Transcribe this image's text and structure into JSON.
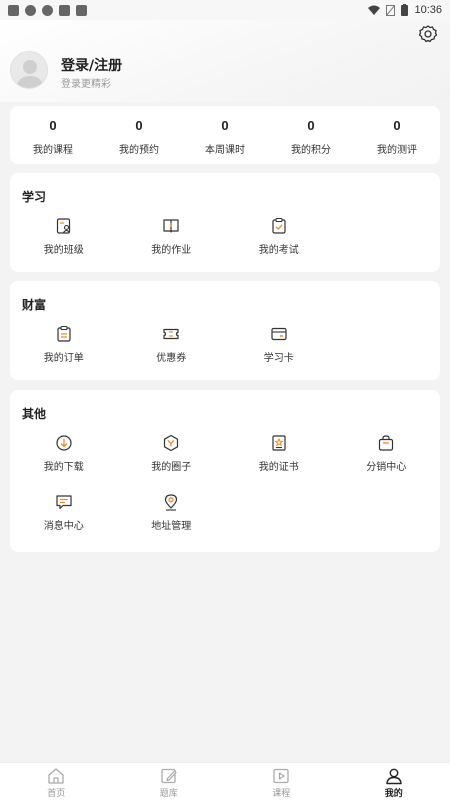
{
  "statusbar": {
    "time": "10:36"
  },
  "user": {
    "title": "登录/注册",
    "subtitle": "登录更精彩"
  },
  "stats": [
    {
      "value": "0",
      "label": "我的课程"
    },
    {
      "value": "0",
      "label": "我的预约"
    },
    {
      "value": "0",
      "label": "本周课时"
    },
    {
      "value": "0",
      "label": "我的积分"
    },
    {
      "value": "0",
      "label": "我的测评"
    }
  ],
  "study": {
    "title": "学习",
    "items": [
      {
        "label": "我的班级",
        "icon": "class-icon"
      },
      {
        "label": "我的作业",
        "icon": "homework-icon"
      },
      {
        "label": "我的考试",
        "icon": "exam-icon"
      }
    ]
  },
  "wealth": {
    "title": "财富",
    "items": [
      {
        "label": "我的订单",
        "icon": "order-icon"
      },
      {
        "label": "优惠券",
        "icon": "coupon-icon"
      },
      {
        "label": "学习卡",
        "icon": "card-icon"
      }
    ]
  },
  "other": {
    "title": "其他",
    "items": [
      {
        "label": "我的下载",
        "icon": "download-icon"
      },
      {
        "label": "我的圈子",
        "icon": "circle-icon"
      },
      {
        "label": "我的证书",
        "icon": "certificate-icon"
      },
      {
        "label": "分销中心",
        "icon": "distribution-icon"
      },
      {
        "label": "消息中心",
        "icon": "message-icon"
      },
      {
        "label": "地址管理",
        "icon": "location-icon"
      }
    ]
  },
  "tabs": [
    {
      "label": "首页",
      "icon": "home-icon",
      "active": false
    },
    {
      "label": "题库",
      "icon": "question-bank-icon",
      "active": false
    },
    {
      "label": "课程",
      "icon": "course-icon",
      "active": false
    },
    {
      "label": "我的",
      "icon": "profile-icon",
      "active": true
    }
  ],
  "colors": {
    "accent": "#f08a24",
    "icon_dark": "#333333",
    "inactive": "#999999"
  }
}
